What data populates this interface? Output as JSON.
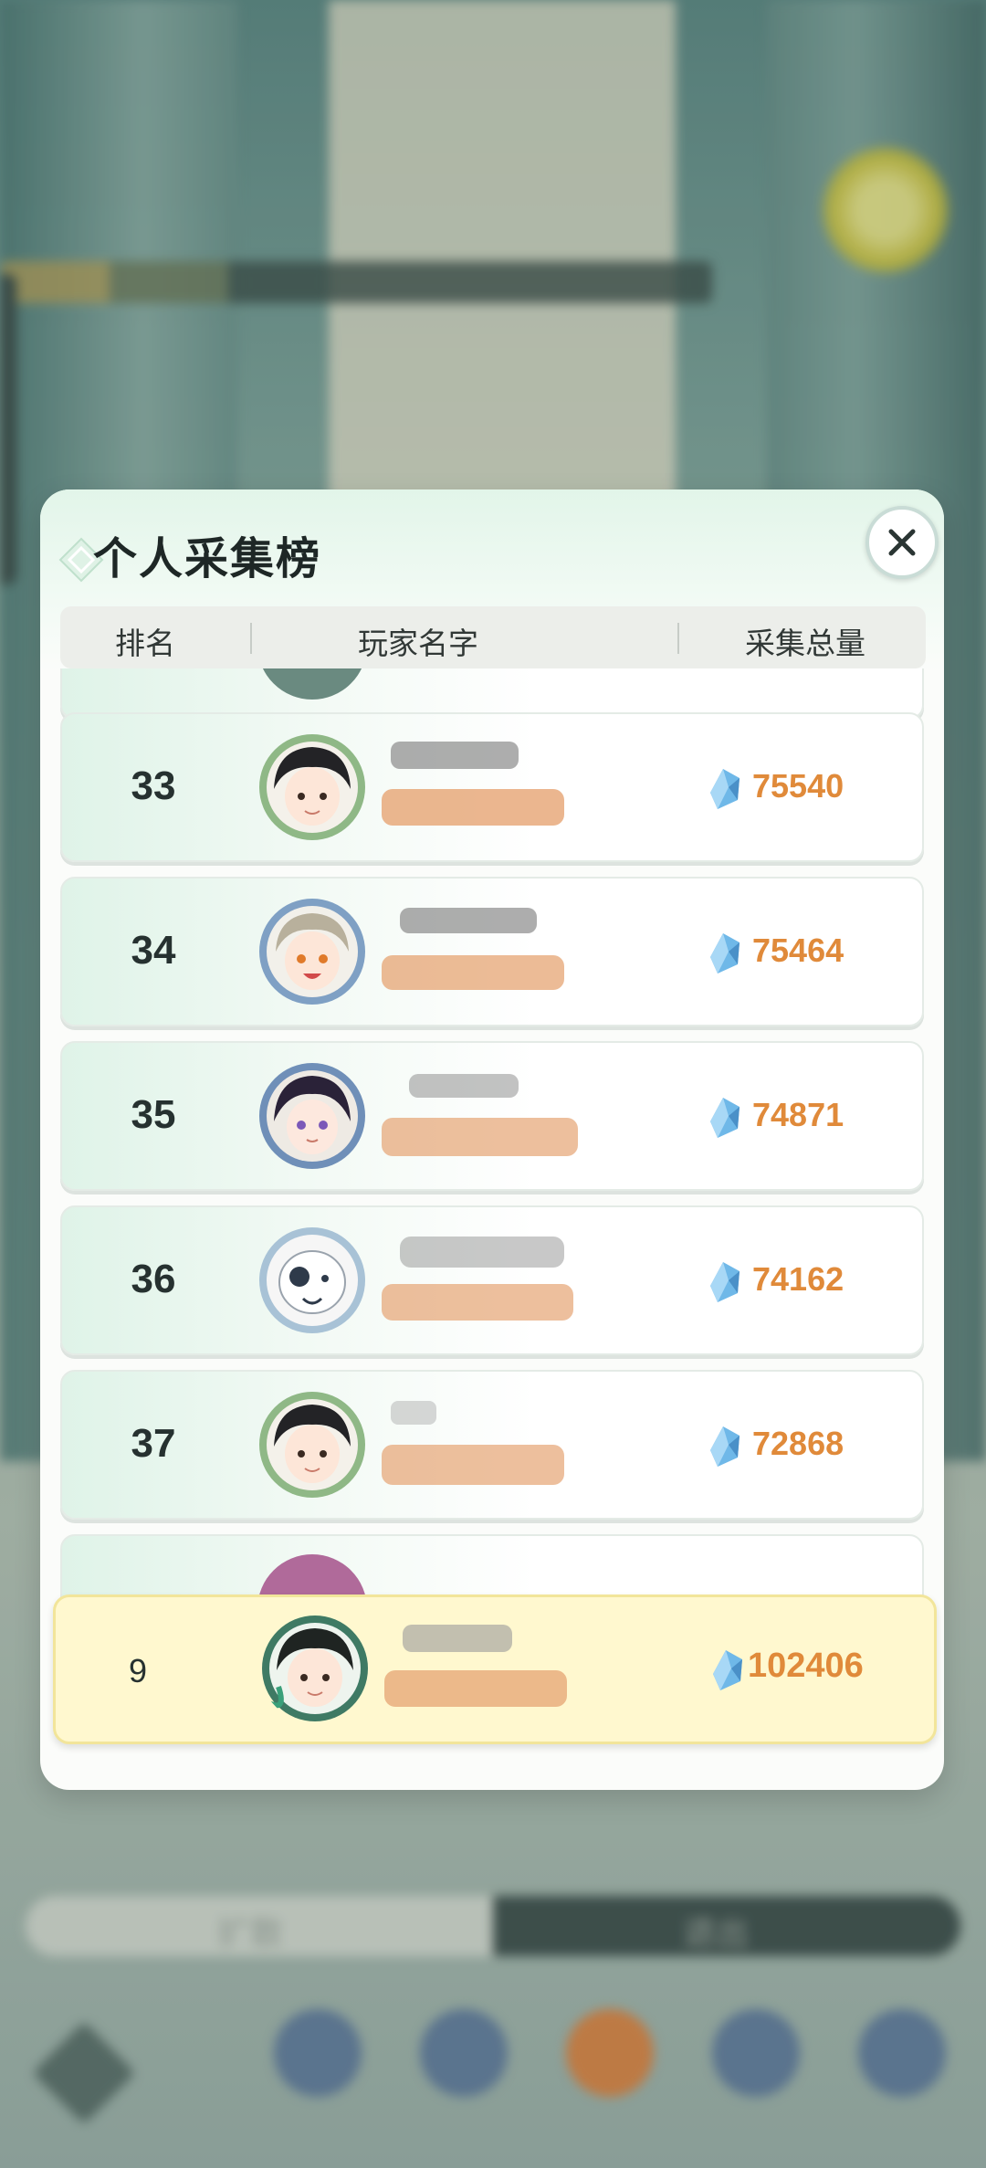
{
  "background": {
    "bottom_bar_left": "扩散",
    "bottom_bar_right": "退出"
  },
  "dialog": {
    "title": "个人采集榜",
    "close_icon": "close-icon",
    "columns": [
      "排名",
      "玩家名字",
      "采集总量"
    ]
  },
  "rows": [
    {
      "rank": "33",
      "score": "75540",
      "avatar_color": "#8fb886"
    },
    {
      "rank": "34",
      "score": "75464",
      "avatar_color": "#7fa0c4"
    },
    {
      "rank": "35",
      "score": "74871",
      "avatar_color": "#6f8fb8"
    },
    {
      "rank": "36",
      "score": "74162",
      "avatar_color": "#a8c2d6"
    },
    {
      "rank": "37",
      "score": "72868",
      "avatar_color": "#8fb886"
    }
  ],
  "self_row": {
    "rank": "9",
    "score": "102406",
    "avatar_color": "#3f7a64"
  },
  "colors": {
    "accent": "#e08a3a",
    "self_bg": "#fff8cf",
    "gem": "#6fb8e8"
  }
}
